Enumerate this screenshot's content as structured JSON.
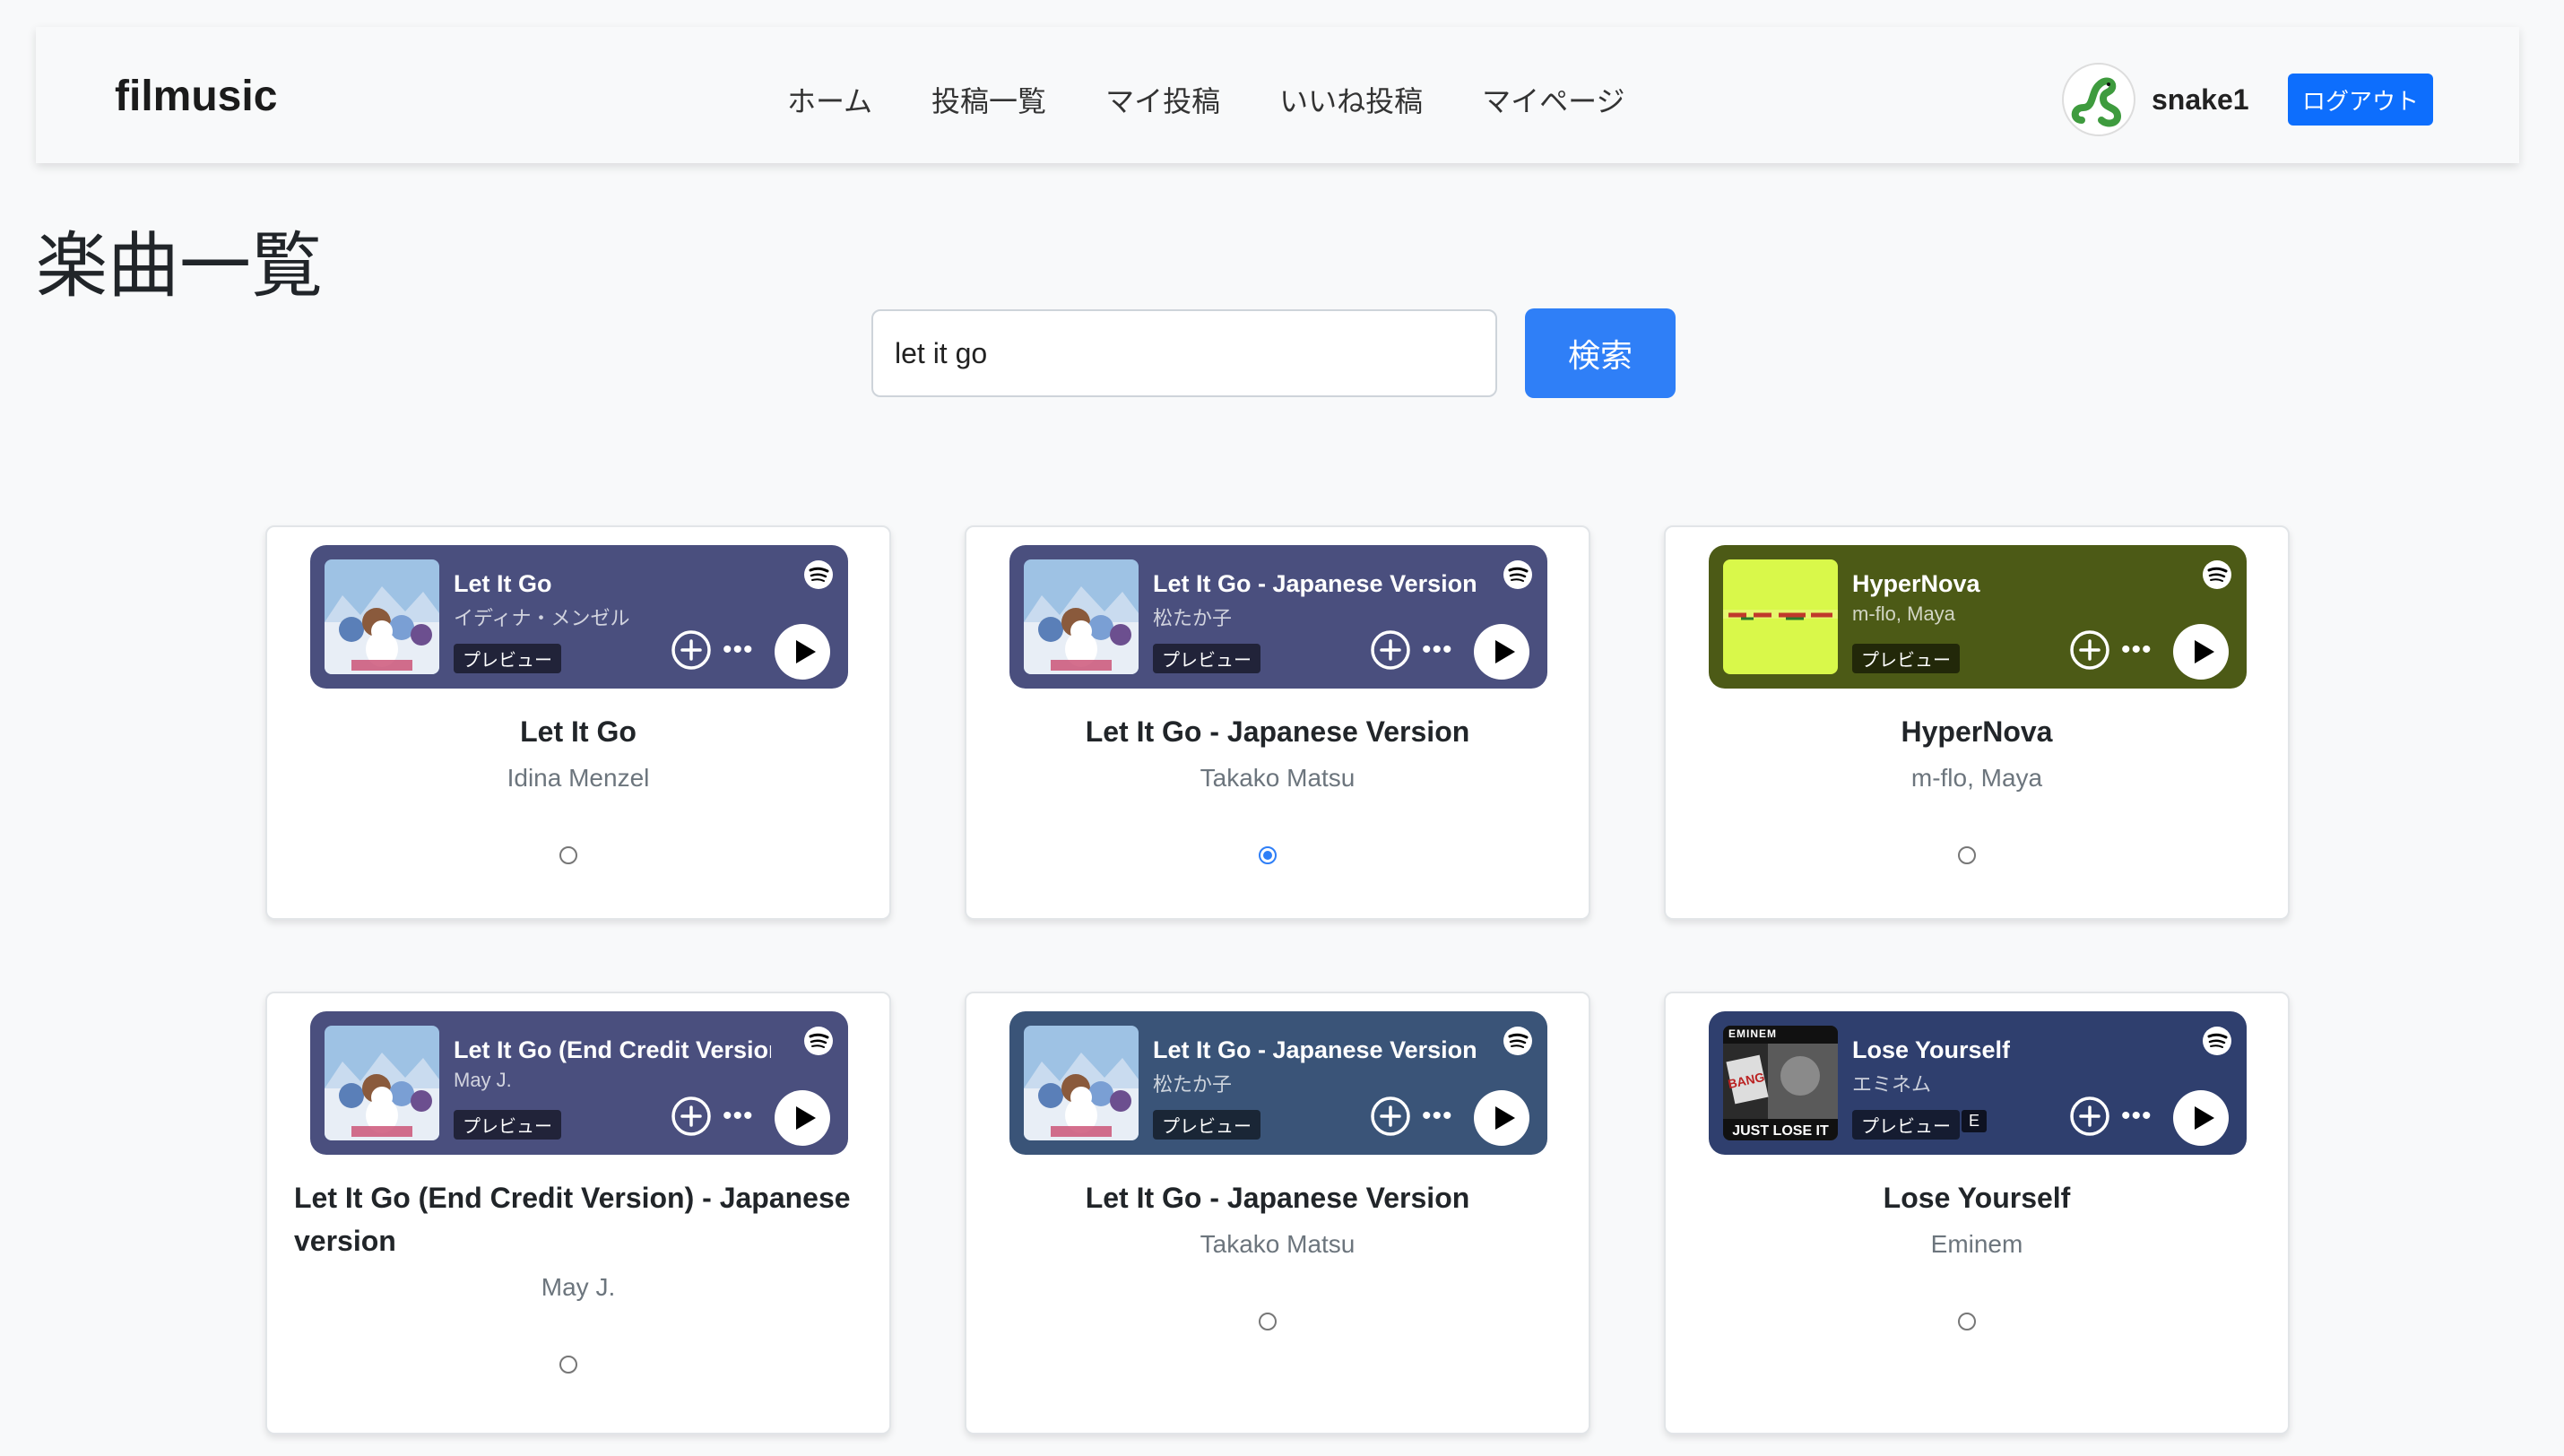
{
  "app": {
    "brand": "filmusic"
  },
  "nav": {
    "items": [
      "ホーム",
      "投稿一覧",
      "マイ投稿",
      "いいね投稿",
      "マイページ"
    ]
  },
  "user": {
    "name": "snake1",
    "logout_label": "ログアウト"
  },
  "page": {
    "title": "楽曲一覧"
  },
  "search": {
    "value": "let it go",
    "button_label": "検索"
  },
  "colors": {
    "accent": "#2f7ff7",
    "navbar_button": "#0d6efd"
  },
  "songs": [
    {
      "embed_title": "Let It Go",
      "embed_artist": "イディナ・メンゼル",
      "preview": "プレビュー",
      "title": "Let It Go",
      "artist": "Idina Menzel",
      "selected": false,
      "embed_color": "#4a4f7e",
      "cover": "frozen"
    },
    {
      "embed_title": "Let It Go - Japanese Version",
      "embed_artist": "松たか子",
      "preview": "プレビュー",
      "title": "Let It Go - Japanese Version",
      "artist": "Takako Matsu",
      "selected": true,
      "embed_color": "#4a4f7e",
      "cover": "frozen"
    },
    {
      "embed_title": "HyperNova",
      "embed_artist": "m-flo, Maya",
      "preview": "プレビュー",
      "title": "HyperNova",
      "artist": "m-flo, Maya",
      "selected": false,
      "embed_color": "#4c5a16",
      "cover": "hypernova"
    },
    {
      "embed_title": "Let It Go (End Credit Version",
      "embed_artist": "May J.",
      "preview": "プレビュー",
      "title": "Let It Go (End Credit Version) - Japanese version",
      "artist": "May J.",
      "selected": false,
      "embed_color": "#4a4f7e",
      "cover": "frozen"
    },
    {
      "embed_title": "Let It Go - Japanese Version",
      "embed_artist": "松たか子",
      "preview": "プレビュー",
      "title": "Let It Go - Japanese Version",
      "artist": "Takako Matsu",
      "selected": false,
      "embed_color": "#3a5478",
      "cover": "frozen"
    },
    {
      "embed_title": "Lose Yourself",
      "embed_artist": "エミネム",
      "preview": "プレビュー",
      "explicit": "E",
      "title": "Lose Yourself",
      "artist": "Eminem",
      "selected": false,
      "embed_color": "#2f3f6e",
      "cover": "eminem",
      "cover_text": "EMINEM"
    }
  ]
}
